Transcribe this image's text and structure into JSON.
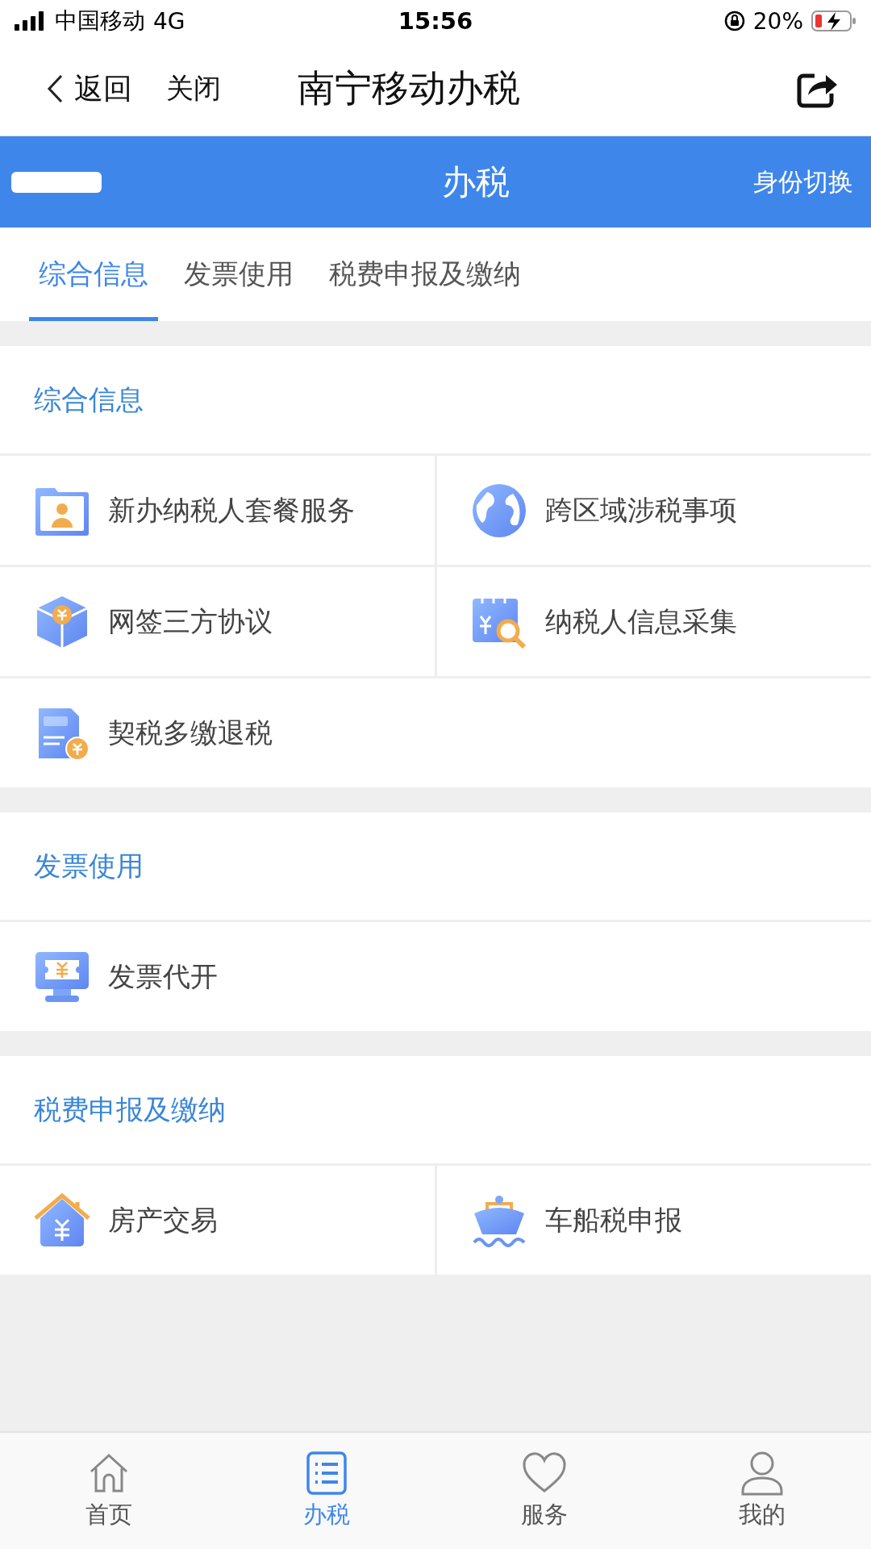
{
  "status_bar": {
    "carrier": "中国移动",
    "network": "4G",
    "time": "15:56",
    "battery": "20%"
  },
  "nav_bar": {
    "back": "返回",
    "close": "关闭",
    "title": "南宁移动办税"
  },
  "header": {
    "title": "办税",
    "switch": "身份切换"
  },
  "tabs": [
    {
      "label": "综合信息",
      "selected": true
    },
    {
      "label": "发票使用",
      "selected": false
    },
    {
      "label": "税费申报及缴纳",
      "selected": false
    }
  ],
  "sections": [
    {
      "title": "综合信息",
      "items": [
        {
          "label": "新办纳税人套餐服务"
        },
        {
          "label": "跨区域涉税事项"
        },
        {
          "label": "网签三方协议"
        },
        {
          "label": "纳税人信息采集"
        },
        {
          "label": "契税多缴退税"
        }
      ]
    },
    {
      "title": "发票使用",
      "items": [
        {
          "label": "发票代开"
        }
      ]
    },
    {
      "title": "税费申报及缴纳",
      "items": [
        {
          "label": "房产交易"
        },
        {
          "label": "车船税申报"
        }
      ]
    }
  ],
  "bottom_nav": [
    {
      "label": "首页",
      "selected": false
    },
    {
      "label": "办税",
      "selected": true
    },
    {
      "label": "服务",
      "selected": false
    },
    {
      "label": "我的",
      "selected": false
    }
  ]
}
